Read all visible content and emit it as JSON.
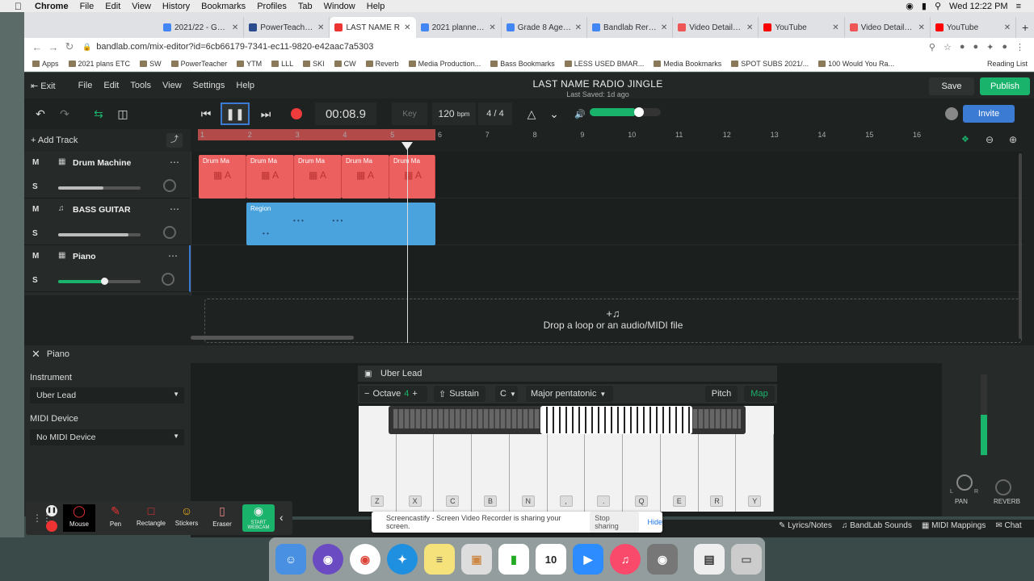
{
  "mac": {
    "app": "Chrome",
    "menus": [
      "File",
      "Edit",
      "View",
      "History",
      "Bookmarks",
      "Profiles",
      "Tab",
      "Window",
      "Help"
    ],
    "clock": "Wed 12:22 PM"
  },
  "tabs": [
    {
      "label": "2021/22 - Google",
      "color": "#4285f4",
      "active": false
    },
    {
      "label": "PowerTeacher Pro",
      "color": "#2a4b8d",
      "active": false
    },
    {
      "label": "LAST NAME R",
      "color": "#e33",
      "active": true
    },
    {
      "label": "2021 planner - Go",
      "color": "#4285f4",
      "active": false
    },
    {
      "label": "Grade 8 Agenda -",
      "color": "#4285f4",
      "active": false
    },
    {
      "label": "Bandlab Reresh -",
      "color": "#4285f4",
      "active": false
    },
    {
      "label": "Video Details - Sc",
      "color": "#e55",
      "active": false
    },
    {
      "label": "YouTube",
      "color": "#f00",
      "active": false
    },
    {
      "label": "Video Details - Sc",
      "color": "#e55",
      "active": false
    },
    {
      "label": "YouTube",
      "color": "#f00",
      "active": false
    }
  ],
  "address": "bandlab.com/mix-editor?id=6cb66179-7341-ec11-9820-e42aac7a5303",
  "bookmarks": [
    "Apps",
    "2021 plans ETC",
    "SW",
    "PowerTeacher",
    "YTM",
    "LLL",
    "SKI",
    "CW",
    "Reverb",
    "Media Production...",
    "Bass Bookmarks",
    "LESS USED BMAR...",
    "Media Bookmarks",
    "SPOT SUBS 2021/...",
    "100 Would You Ra..."
  ],
  "reading_list": "Reading List",
  "app": {
    "exit": "Exit",
    "menus": [
      "File",
      "Edit",
      "Tools",
      "View",
      "Settings",
      "Help"
    ],
    "title": "LAST NAME RADIO JINGLE",
    "saved": "Last Saved: 1d ago",
    "save": "Save",
    "publish": "Publish",
    "invite": "Invite"
  },
  "transport": {
    "time": "00:08.9",
    "key": "Key",
    "bpm": "120",
    "bpm_unit": "bpm",
    "signature": "4 / 4"
  },
  "ruler": [
    "1",
    "2",
    "3",
    "4",
    "5",
    "6",
    "7",
    "8",
    "9",
    "10",
    "11",
    "12",
    "13",
    "14",
    "15",
    "16"
  ],
  "add_track": "Add Track",
  "tracks": [
    {
      "mute": "M",
      "solo": "S",
      "name": "Drum Machine",
      "volume": 0.55
    },
    {
      "mute": "M",
      "solo": "S",
      "name": "BASS GUITAR",
      "volume": 0.85
    },
    {
      "mute": "M",
      "solo": "S",
      "name": "Piano",
      "volume": 0.55
    }
  ],
  "drum_region_label": "Drum Ma",
  "bass_region_label": "Region",
  "dropzone": "Drop a loop or an audio/MIDI file",
  "panel": {
    "title": "Piano",
    "instrument_label": "Instrument",
    "instrument": "Uber Lead",
    "midi_label": "MIDI Device",
    "midi": "No MIDI Device"
  },
  "keyboard": {
    "title": "Uber Lead",
    "octave_label": "Octave",
    "octave": "4",
    "sustain": "Sustain",
    "key": "C",
    "scale": "Major pentatonic",
    "pitch": "Pitch",
    "map": "Map",
    "keys": [
      "Z",
      "X",
      "C",
      "B",
      "N",
      ",",
      ".",
      "Q",
      "E",
      "R",
      "Y"
    ]
  },
  "mixer": {
    "pan": "PAN",
    "reverb": "REVERB",
    "l": "L",
    "r": "R"
  },
  "bottom": [
    "Lyrics/Notes",
    "BandLab Sounds",
    "MIDI Mappings",
    "Chat"
  ],
  "share": {
    "msg": "Screencastify - Screen Video Recorder is sharing your screen.",
    "stop": "Stop sharing",
    "hide": "Hide"
  },
  "castify": [
    "Mouse",
    "Pen",
    "Rectangle",
    "Stickers",
    "Eraser",
    "START WEBCAM"
  ]
}
